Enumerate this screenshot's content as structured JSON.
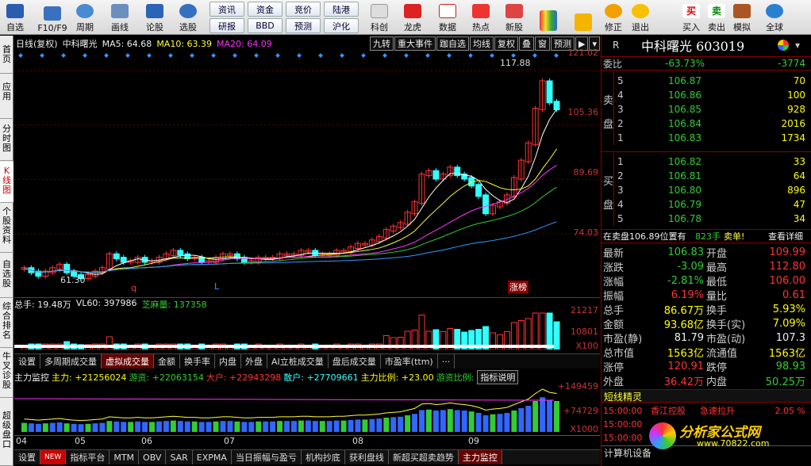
{
  "toolbar": {
    "items": [
      {
        "label": "自选",
        "icon": "star-icon"
      },
      {
        "label": "F10/F9",
        "icon": "f10-icon"
      },
      {
        "label": "周期",
        "icon": "clock-icon"
      },
      {
        "label": "画线",
        "icon": "pencil-icon"
      },
      {
        "label": "论股",
        "icon": "forum-icon"
      },
      {
        "label": "选股",
        "icon": "chart-select-icon"
      }
    ],
    "small": [
      "资讯",
      "资金",
      "竞价",
      "陆港",
      "研报",
      "BBD",
      "预测",
      "沪化"
    ],
    "items2": [
      {
        "label": "科创",
        "icon": "kechuang-icon"
      },
      {
        "label": "龙虎",
        "icon": "dragon-icon"
      },
      {
        "label": "数据",
        "icon": "pe-icon"
      },
      {
        "label": "热点",
        "icon": "hot-icon"
      },
      {
        "label": "新股",
        "icon": "newstock-icon"
      }
    ],
    "items3": [
      {
        "label": "修正",
        "icon": "alarm-icon"
      },
      {
        "label": "退出",
        "icon": "exit-icon"
      },
      {
        "label": "买入",
        "icon": "buy-icon"
      },
      {
        "label": "卖出",
        "icon": "sell-icon"
      },
      {
        "label": "模拟",
        "icon": "hammer-icon"
      },
      {
        "label": "全球",
        "icon": "globe-icon"
      }
    ],
    "buy": "买",
    "sell": "卖"
  },
  "sidebar": [
    "首页",
    "应用",
    "分时图",
    "K线图",
    "个股资料",
    "自选股",
    "综合排名",
    "牛叉诊股",
    "超级盘口"
  ],
  "chart": {
    "header": {
      "title": "日线(复权)",
      "name": "中科曙光",
      "ma5": "MA5: 64.68",
      "ma10": "MA10: 63.39",
      "ma20": "MA20: 64.09"
    },
    "buttons": [
      "九转",
      "重大事件",
      "跏自选",
      "均线",
      "复权",
      "叠",
      "窗",
      "预测"
    ],
    "y_main": [
      "121.02",
      "105.36",
      "89.69",
      "74.03"
    ],
    "hi": "117.88",
    "lo": "61.30",
    "marks": {
      "q": "q",
      "l": "L",
      "zb": "涨榜"
    },
    "vol": {
      "a": "总手: 19.48万",
      "b": "VL60: 397986",
      "c": "芝麻量: 137358",
      "y": [
        "21217",
        "10801"
      ],
      "unit": "X100"
    },
    "tabs1": [
      "设置",
      "多周期成交量",
      "虚拟成交量",
      "金额",
      "换手率",
      "内盘",
      "外盘",
      "AI立桩成交量",
      "盘后成交量",
      "市盈率(ttm)",
      "···"
    ],
    "flow": {
      "a": "主力监控",
      "b": "主力: +21256024",
      "c": "游资: +22063154",
      "d": "大户: +22943298",
      "e": "散户: +27709661",
      "f": "主力比例: +23.00",
      "g": "游资比例:",
      "btn": "指标说明",
      "y": [
        "+149459",
        "+74729"
      ],
      "unit": "X1000"
    },
    "months": [
      "04",
      "05",
      "06",
      "07",
      "08",
      "09"
    ],
    "tabs2": [
      "设置",
      "NEW",
      "指标平台",
      "MTM",
      "OBV",
      "SAR",
      "EXPMA",
      "当日振幅与盈亏",
      "机构抄底",
      "获利盘线",
      "新超买超卖趋势",
      "主力监控"
    ]
  },
  "chart_data": {
    "type": "candlestick",
    "y_range": [
      58,
      122
    ],
    "closes": [
      64,
      63,
      62,
      63,
      64,
      65,
      63,
      62,
      61.3,
      62,
      63,
      64,
      68,
      67,
      66,
      66,
      67,
      66,
      66,
      67,
      68,
      69,
      68,
      67,
      67,
      66,
      66,
      67,
      68,
      68,
      67,
      66,
      66,
      67,
      67,
      67,
      68,
      68,
      68,
      69,
      69,
      68,
      68,
      68,
      69,
      69,
      70,
      71,
      71,
      72,
      73,
      75,
      76,
      77,
      80,
      83,
      91,
      92,
      90,
      91,
      93,
      91,
      90,
      88,
      85,
      80,
      82,
      83,
      85,
      90,
      95,
      100,
      110,
      117.88,
      112,
      110
    ]
  },
  "right": {
    "code": "R",
    "name": "中科曙光 603019",
    "weibi": {
      "label": "委比",
      "pct": "-63.73%",
      "val": "-3774"
    },
    "sell": [
      {
        "n": "5",
        "p": "106.87",
        "v": "70"
      },
      {
        "n": "4",
        "p": "106.86",
        "v": "100"
      },
      {
        "n": "3",
        "p": "106.85",
        "v": "928"
      },
      {
        "n": "2",
        "p": "106.84",
        "v": "2016"
      },
      {
        "n": "1",
        "p": "106.83",
        "v": "1734"
      }
    ],
    "sell_label": "卖盘",
    "buy_label": "买盘",
    "buy": [
      {
        "n": "1",
        "p": "106.82",
        "v": "33"
      },
      {
        "n": "2",
        "p": "106.81",
        "v": "64"
      },
      {
        "n": "3",
        "p": "106.80",
        "v": "896"
      },
      {
        "n": "4",
        "p": "106.79",
        "v": "47"
      },
      {
        "n": "5",
        "p": "106.78",
        "v": "34"
      }
    ],
    "pos": {
      "a": "在卖盘106.89位置有",
      "b": "823手",
      "c": "卖单!",
      "d": "查看详细"
    },
    "stats": [
      [
        "最新",
        "106.83",
        "开盘",
        "109.99"
      ],
      [
        "涨跌",
        "-3.09",
        "最高",
        "112.80"
      ],
      [
        "涨幅",
        "-2.81%",
        "最低",
        "106.00"
      ],
      [
        "振幅",
        "6.19%",
        "量比",
        "0.61"
      ],
      [
        "总手",
        "86.67万",
        "换手",
        "5.93%"
      ],
      [
        "金额",
        "93.68亿",
        "换手(实)",
        "7.09%"
      ],
      [
        "市盈(静)",
        "81.79",
        "市盈(动)",
        "107.3"
      ],
      [
        "总市值",
        "1563亿",
        "流通值",
        "1563亿"
      ],
      [
        "涨停",
        "120.91",
        "跌停",
        "98.93"
      ],
      [
        "外盘",
        "36.42万",
        "内盘",
        "50.25万"
      ]
    ],
    "elf": {
      "title": "短线精灵",
      "rows": [
        [
          "15:00:00",
          "香江控股",
          "急速拉升",
          "2.05 %"
        ],
        [
          "15:00:00",
          "",
          "",
          ""
        ],
        [
          "15:00:00",
          "",
          "",
          ""
        ]
      ]
    },
    "footer": "计算机设备",
    "watermark": "分析家公式网",
    "site": "www.70822.com"
  }
}
